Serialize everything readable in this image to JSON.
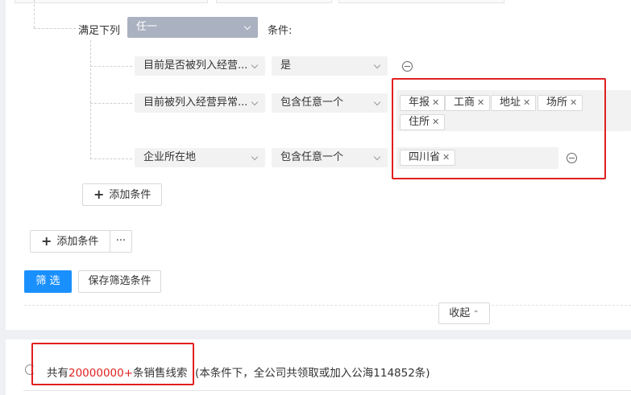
{
  "condition_group": {
    "match_label": "满足下列",
    "match_value": "任一",
    "condition_suffix": "条件:"
  },
  "conditions": [
    {
      "field": "目前是否被列入经营...",
      "operator": "是",
      "values": []
    },
    {
      "field": "目前被列入经营异常...",
      "operator": "包含任意一个",
      "values": [
        "年报",
        "工商",
        "地址",
        "场所",
        "住所"
      ]
    },
    {
      "field": "企业所在地",
      "operator": "包含任意一个",
      "values": [
        "四川省"
      ]
    }
  ],
  "inner_add_condition": "添加条件",
  "outer_add_condition": "添加条件",
  "more_button": "···",
  "filter_button": "筛 选",
  "save_filter_button": "保存筛选条件",
  "collapse_label": "收起",
  "results": {
    "prefix": "共有",
    "count": "20000000+",
    "suffix": "条销售线索",
    "note": "(本条件下，全公司共领取或加入公海114852条)"
  },
  "colors": {
    "accent": "#1a90ff",
    "highlight": "#e02020",
    "count_red": "#e02020"
  }
}
